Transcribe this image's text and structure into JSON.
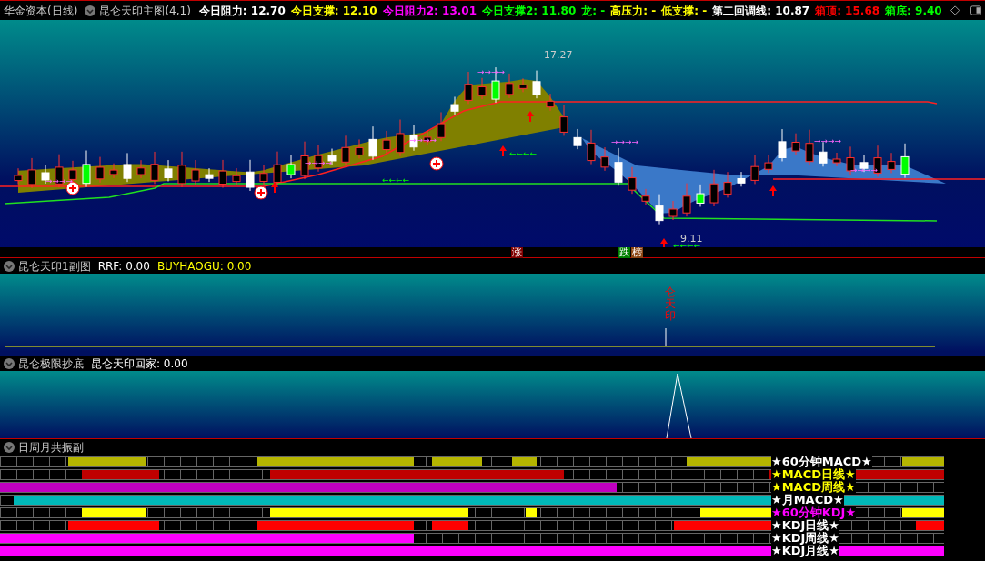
{
  "header": {
    "stock": "华金资本(日线)",
    "indicator": "昆仑天印主图(4,1)",
    "values": [
      {
        "text": "今日阻力: 12.70",
        "color": "#ffffff"
      },
      {
        "text": "今日支撑: 12.10",
        "color": "#ffff00"
      },
      {
        "text": "今日阻力2: 13.01",
        "color": "#ff00ff"
      },
      {
        "text": "今日支撑2: 11.80",
        "color": "#00ff00"
      },
      {
        "text": "龙: -",
        "color": "#00ff00"
      },
      {
        "text": "高压力: -",
        "color": "#ffff00"
      },
      {
        "text": "低支撑: -",
        "color": "#ffff00"
      },
      {
        "text": "第二回调线: 10.87",
        "color": "#ffffff"
      },
      {
        "text": "箱顶: 15.68",
        "color": "#ff0000"
      },
      {
        "text": "箱底: 9.40",
        "color": "#00ff00"
      }
    ]
  },
  "main_chart": {
    "high_label": "17.27",
    "low_label": "9.11",
    "arrows": [
      "→→→→",
      "→→→→",
      "→→→→",
      "→→→→",
      "→→→→",
      "→→→→",
      "→→→→",
      "←←←←",
      "←←←←",
      "←←←←"
    ],
    "badges": [
      {
        "text": "涨",
        "color": "#800000"
      },
      {
        "text": "跌",
        "color": "#008000"
      },
      {
        "text": "榜",
        "color": "#8b4513"
      }
    ]
  },
  "panel_2": {
    "title": "昆仑天印1副图",
    "values": [
      {
        "text": "RRF: 0.00",
        "color": "#ffffff"
      },
      {
        "text": "BUYHAOGU: 0.00",
        "color": "#ffff00"
      }
    ],
    "vertical_text": "仑天印"
  },
  "panel_3": {
    "title": "昆仑极限抄底",
    "values": [
      {
        "text": "昆仑天印回家: 0.00"
      }
    ]
  },
  "panel_4": {
    "title": "日周月共振副",
    "rows": [
      {
        "label": {
          "text": "★60分钟MACD★",
          "color": "#ffffff"
        },
        "color": "#b5b500"
      },
      {
        "label": {
          "text": "★MACD日线★",
          "color": "#ffff00"
        },
        "color": "#c00000"
      },
      {
        "label": {
          "text": "★MACD周线★",
          "color": "#ffff00"
        },
        "color": "#c000c0"
      },
      {
        "label": {
          "text": "★月MACD★",
          "color": "#ffffff"
        },
        "color": "#00b8b8"
      },
      {
        "label": {
          "text": "★60分钟KDJ★",
          "color": "#ff00ff"
        },
        "color": "#ffff00"
      },
      {
        "label": {
          "text": "★KDJ日线★",
          "color": "#ffffff"
        },
        "color": "#ff0000"
      },
      {
        "label": {
          "text": "★KDJ周线★",
          "color": "#ffffff"
        },
        "color": "#ff00ff"
      },
      {
        "label": {
          "text": "★KDJ月线★",
          "color": "#ffffff"
        },
        "color": "#ff00ff"
      }
    ]
  }
}
